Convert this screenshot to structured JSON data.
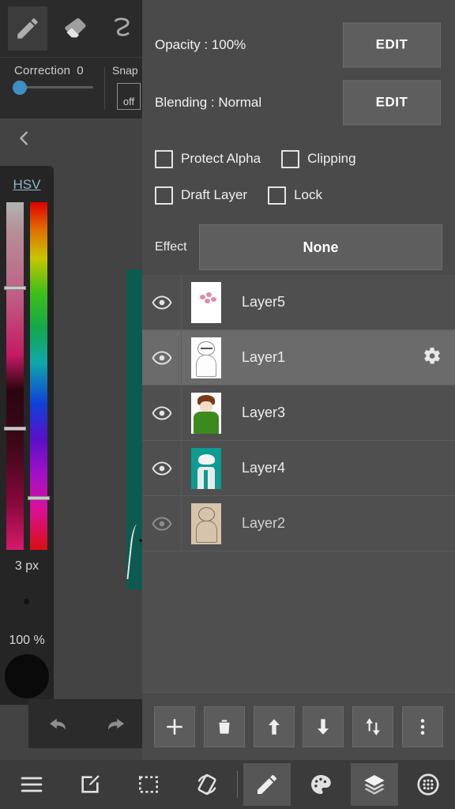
{
  "tools": {
    "items": [
      {
        "name": "pencil-tool",
        "icon": "pencil-icon",
        "active": true
      },
      {
        "name": "eraser-tool",
        "icon": "eraser-icon",
        "active": false
      },
      {
        "name": "curve-tool",
        "icon": "curve-icon",
        "active": false
      }
    ],
    "correction_label": "Correction",
    "correction_value": "0",
    "snap_label": "Snap",
    "snap_state": "off"
  },
  "color_picker": {
    "mode_label": "HSV",
    "brush_size": "3 px",
    "brush_opacity": "100 %",
    "swatch_color": "#0a0a0a"
  },
  "history": {
    "undo_label": "undo-icon",
    "redo_label": "redo-icon"
  },
  "layer_panel": {
    "opacity_label": "Opacity : 100%",
    "opacity_edit": "EDIT",
    "blending_label": "Blending : Normal",
    "blending_edit": "EDIT",
    "checkboxes": [
      {
        "label": "Protect Alpha",
        "checked": false
      },
      {
        "label": "Clipping",
        "checked": false
      },
      {
        "label": "Draft Layer",
        "checked": false
      },
      {
        "label": "Lock",
        "checked": false
      }
    ],
    "effect_label": "Effect",
    "effect_value": "None",
    "layers": [
      {
        "name": "Layer5",
        "visible": true,
        "selected": false,
        "thumb": "pink-dots"
      },
      {
        "name": "Layer1",
        "visible": true,
        "selected": true,
        "thumb": "line-sketch"
      },
      {
        "name": "Layer3",
        "visible": true,
        "selected": false,
        "thumb": "color-character"
      },
      {
        "name": "Layer4",
        "visible": true,
        "selected": false,
        "thumb": "teal-figure"
      },
      {
        "name": "Layer2",
        "visible": false,
        "selected": false,
        "thumb": "sepia-sketch"
      }
    ],
    "tools": [
      {
        "name": "add-layer-button",
        "icon": "plus-icon"
      },
      {
        "name": "delete-layer-button",
        "icon": "trash-icon"
      },
      {
        "name": "move-layer-up-button",
        "icon": "arrow-up-icon"
      },
      {
        "name": "move-layer-down-button",
        "icon": "arrow-down-icon"
      },
      {
        "name": "reorder-layer-button",
        "icon": "swap-vertical-icon"
      },
      {
        "name": "layer-more-options-button",
        "icon": "more-vertical-icon"
      }
    ]
  },
  "bottom_nav": [
    {
      "name": "nav-menu",
      "icon": "hamburger-icon",
      "active": false
    },
    {
      "name": "nav-edit",
      "icon": "edit-square-icon",
      "active": false
    },
    {
      "name": "nav-select",
      "icon": "marquee-select-icon",
      "active": false
    },
    {
      "name": "nav-rotate",
      "icon": "rotate-screen-icon",
      "active": false
    },
    {
      "name": "nav-brush",
      "icon": "pencil-icon",
      "active": true
    },
    {
      "name": "nav-palette",
      "icon": "palette-icon",
      "active": false
    },
    {
      "name": "nav-layers",
      "icon": "layers-icon",
      "active": true
    },
    {
      "name": "nav-material",
      "icon": "texture-circle-icon",
      "active": false
    }
  ],
  "colors": {
    "panel_bg": "#4a4a4a",
    "list_bg": "#4f4f4f",
    "selected_row": "#6b6b6b",
    "canvas_teal": "#0d5a50",
    "accent_blue": "#3e8fc4",
    "hsv_title": "#8fb6c9"
  }
}
